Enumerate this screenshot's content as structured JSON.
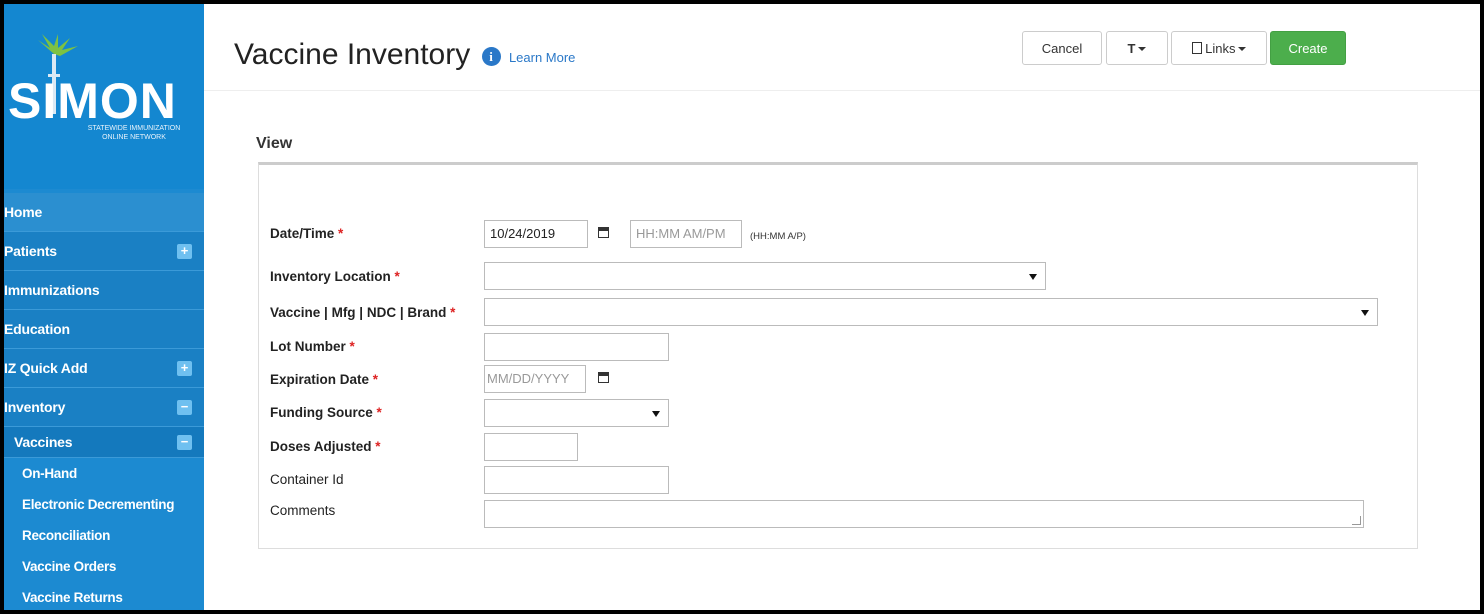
{
  "logo": {
    "brand": "SIMON",
    "subtitle_line1": "STATEWIDE IMMUNIZATION",
    "subtitle_line2": "ONLINE NETWORK"
  },
  "nav": {
    "home": "Home",
    "patients": "Patients",
    "immunizations": "Immunizations",
    "education": "Education",
    "iz_quick_add": "IZ Quick Add",
    "inventory": "Inventory",
    "vaccines": "Vaccines",
    "sub": [
      "On-Hand",
      "Electronic Decrementing",
      "Reconciliation",
      "Vaccine Orders",
      "Vaccine Returns"
    ],
    "expand_symbol": "+",
    "collapse_symbol": "−"
  },
  "header": {
    "title": "Vaccine Inventory",
    "info_symbol": "i",
    "learn_more": "Learn More",
    "cancel": "Cancel",
    "tools_symbol": "T",
    "links": "Links",
    "create": "Create"
  },
  "form": {
    "section": "View",
    "datetime_label": "Date/Time",
    "date_value": "10/24/2019",
    "time_placeholder": "HH:MM AM/PM",
    "time_hint": "(HH:MM A/P)",
    "location_label": "Inventory Location",
    "vaccine_label": "Vaccine | Mfg | NDC | Brand",
    "lot_label": "Lot Number",
    "expiration_label": "Expiration Date",
    "expiration_placeholder": "MM/DD/YYYY",
    "funding_label": "Funding Source",
    "doses_label": "Doses Adjusted",
    "container_label": "Container Id",
    "comments_label": "Comments",
    "required_mark": "*"
  },
  "colors": {
    "sidebar": "#1c8ad1",
    "create_button": "#4cae4c",
    "link": "#2a78c8",
    "required": "#d22222"
  }
}
